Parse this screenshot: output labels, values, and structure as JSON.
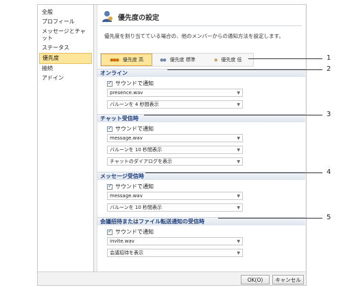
{
  "sidebar": {
    "items": [
      {
        "label": "全般"
      },
      {
        "label": "プロフィール"
      },
      {
        "label": "メッセージとチャ\nット"
      },
      {
        "label": "ステータス"
      },
      {
        "label": "優先度"
      },
      {
        "label": "接続"
      },
      {
        "label": "アドイン"
      }
    ],
    "selected_index": 4
  },
  "main": {
    "title": "優先度の設定",
    "description": "優先度を割り当てている場合の、他のメンバーからの通知方法を設定します。",
    "priority_tabs": [
      {
        "mark": "●●●",
        "label": "優先度 高",
        "active": true
      },
      {
        "mark": "●●",
        "label": "優先度 標準",
        "active": false
      },
      {
        "mark": "●",
        "label": "優先度 低",
        "active": false
      }
    ],
    "sections": [
      {
        "title": "オンライン",
        "sound_label": "サウンドで通知",
        "sound_value": "presence.wav",
        "balloon_value": "バルーンを 4 秒間表示"
      },
      {
        "title": "チャット受信時",
        "sound_label": "サウンドで通知",
        "sound_value": "message.wav",
        "balloon_value": "バルーンを 10 秒間表示",
        "extra_value": "チャットのダイアログを表示"
      },
      {
        "title": "メッセージ受信時",
        "sound_label": "サウンドで通知",
        "sound_value": "message.wav",
        "balloon_value": "バルーンを 10 秒間表示"
      },
      {
        "title": "会議招待またはファイル転送通知の受信時",
        "sound_label": "サウンドで通知",
        "sound_value": "invite.wav",
        "balloon_value": "会議招待を表示"
      }
    ]
  },
  "footer": {
    "ok_label": "OK(O)",
    "cancel_label": "キャンセル"
  },
  "callouts": [
    "1",
    "2",
    "3",
    "4",
    "5"
  ],
  "colors": {
    "selected_bg": "#fde59a",
    "section_title": "#1f3f7a",
    "priority_high_mark": "#d06a00"
  }
}
